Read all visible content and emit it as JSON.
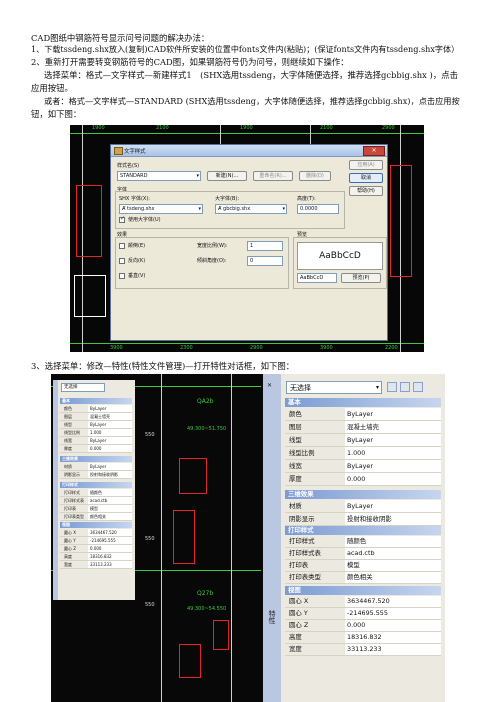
{
  "doc": {
    "title_line": "CAD图纸中钢筋符号显示问号问题的解决办法：",
    "step1": "1、下载tssdeng.shx放入(复制)CAD软件所安装的位置中fonts文件内(粘贴)；(保证fonts文件内有tssdeng.shx字体）",
    "step2": "2、重新打开需要转变钢筋符号的CAD图，如果钢筋符号仍为问号，则继续如下操作：",
    "method_a_1": "选择菜单：格式—文字样式—新建样式1　(SHX选用tssdeng，大字体随便选择，推荐选择gcbbig.shx )，点击",
    "method_a_2": "应用按钮。",
    "method_b_1": "或者：格式—文字样式—STANDARD (SHX选用tssdeng，大字体随便选择，推荐选择gcbbig.shx)，点击应用按",
    "method_b_2": "钮，如下图：",
    "step3": "3、选择菜单：修改—特性(特性文件管理)—打开特性对话框，如下图："
  },
  "dialog": {
    "title": "文字样式",
    "style_name_label": "样式名(S)",
    "style_name_value": "STANDARD",
    "btn_new": "新建(N)...",
    "btn_rename": "重命名(R)...",
    "btn_delete": "删除(D)",
    "btn_apply": "应用(A)",
    "btn_cancel": "取消",
    "btn_help": "帮助(H)",
    "font_group": "字体",
    "shx_label": "SHX 字体(X):",
    "shx_value": "tsdeng.shx",
    "bigfont_label": "大字体(B):",
    "bigfont_value": "gbcbig.shx",
    "height_label": "高度(T):",
    "height_value": "0.0000",
    "use_bigfont": "使用大字体(U)",
    "effects_group": "效果",
    "upside_down": "颠倒(E)",
    "backwards": "反向(K)",
    "vertical": "垂直(V)",
    "width_factor_label": "宽度比例(W):",
    "width_factor_value": "1",
    "oblique_label": "倾斜角度(O):",
    "oblique_value": "0",
    "preview_group": "预览",
    "preview_text": "AaBbCcD",
    "preview_input": "AaBbCcD",
    "preview_button": "预览(P)"
  },
  "cad_top": {
    "dims_top": [
      "1900",
      "2100",
      "1900",
      "2100",
      "2900"
    ],
    "dims_bottom": [
      "3900",
      "2300",
      "2900",
      "3900",
      "2200"
    ]
  },
  "panel_small": {
    "select": "无选择",
    "sec_basic": "基本",
    "rows_basic": [
      [
        "颜色",
        "ByLayer"
      ],
      [
        "图层",
        "混凝土墙壳"
      ],
      [
        "线型",
        "ByLayer"
      ],
      [
        "线型比例",
        "1.000"
      ],
      [
        "线宽",
        "ByLayer"
      ],
      [
        "厚度",
        "0.000"
      ]
    ],
    "sec_3d": "三维效果",
    "rows_3d": [
      [
        "材质",
        "ByLayer"
      ],
      [
        "阴影显示",
        "投射和接收阴影"
      ]
    ],
    "sec_print": "打印样式",
    "rows_print": [
      [
        "打印样式",
        "随颜色"
      ],
      [
        "打印样式表",
        "acad.ctb"
      ],
      [
        "打印表",
        "模型"
      ],
      [
        "打印表类型",
        "颜色相关"
      ]
    ],
    "sec_view": "视图",
    "rows_view": [
      [
        "圆心 X",
        "3634467.520"
      ],
      [
        "圆心 Y",
        "-214695.555"
      ],
      [
        "圆心 Z",
        "0.000"
      ],
      [
        "高度",
        "18316.832"
      ],
      [
        "宽度",
        "33113.233"
      ]
    ]
  },
  "panel_large": {
    "select": "无选择",
    "sec_basic": "基本",
    "rows_basic": [
      [
        "颜色",
        "ByLayer"
      ],
      [
        "图层",
        "混凝土墙壳"
      ],
      [
        "线型",
        "ByLayer"
      ],
      [
        "线型比例",
        "1.000"
      ],
      [
        "线宽",
        "ByLayer"
      ],
      [
        "厚度",
        "0.000"
      ]
    ],
    "sec_3d": "三维效果",
    "rows_3d": [
      [
        "材质",
        "ByLayer"
      ],
      [
        "阴影显示",
        "投射和接收阴影"
      ]
    ],
    "sec_print": "打印样式",
    "rows_print": [
      [
        "打印样式",
        "随颜色"
      ],
      [
        "打印样式表",
        "acad.ctb"
      ],
      [
        "打印表",
        "模型"
      ],
      [
        "打印表类型",
        "颜色相关"
      ]
    ],
    "sec_view": "视图",
    "rows_view": [
      [
        "圆心 X",
        "3634467.520"
      ],
      [
        "圆心 Y",
        "-214695.555"
      ],
      [
        "圆心 Z",
        "0.000"
      ],
      [
        "高度",
        "18316.832"
      ],
      [
        "宽度",
        "33113.233"
      ]
    ],
    "side_label": "特性"
  },
  "cad_mid": {
    "labels": [
      "QA2b",
      "49.300~51.750",
      "Q27b",
      "49.300~54.550",
      "550",
      "550",
      "550"
    ]
  },
  "colors": {
    "cad_bg": "#070707",
    "dialog_bg": "#ece9d8",
    "accent": "#7b9bd2",
    "cad_green": "#3ec83e",
    "cad_red": "#e0262a"
  }
}
